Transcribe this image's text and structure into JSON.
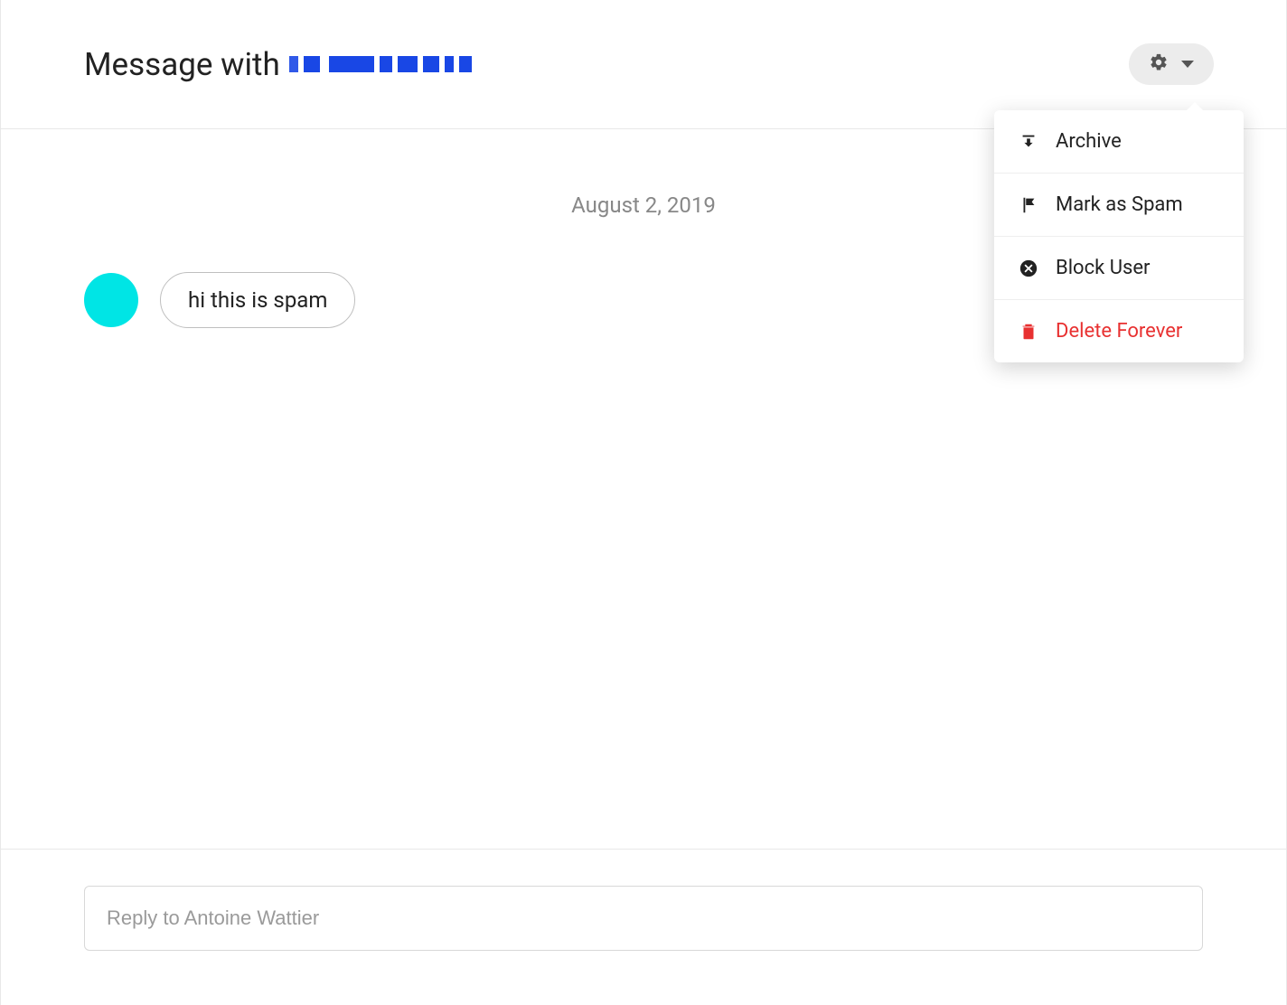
{
  "header": {
    "title_prefix": "Message with",
    "recipient_redacted": true
  },
  "date_divider": "August 2, 2019",
  "messages": [
    {
      "from": "other",
      "avatar_color": "#00e5e5",
      "text": "hi this is spam"
    }
  ],
  "settings_menu": {
    "items": [
      {
        "icon": "archive-icon",
        "label": "Archive"
      },
      {
        "icon": "flag-icon",
        "label": "Mark as Spam"
      },
      {
        "icon": "block-icon",
        "label": "Block User"
      },
      {
        "icon": "trash-icon",
        "label": "Delete Forever",
        "danger": true
      }
    ]
  },
  "reply": {
    "placeholder": "Reply to Antoine Wattier"
  }
}
